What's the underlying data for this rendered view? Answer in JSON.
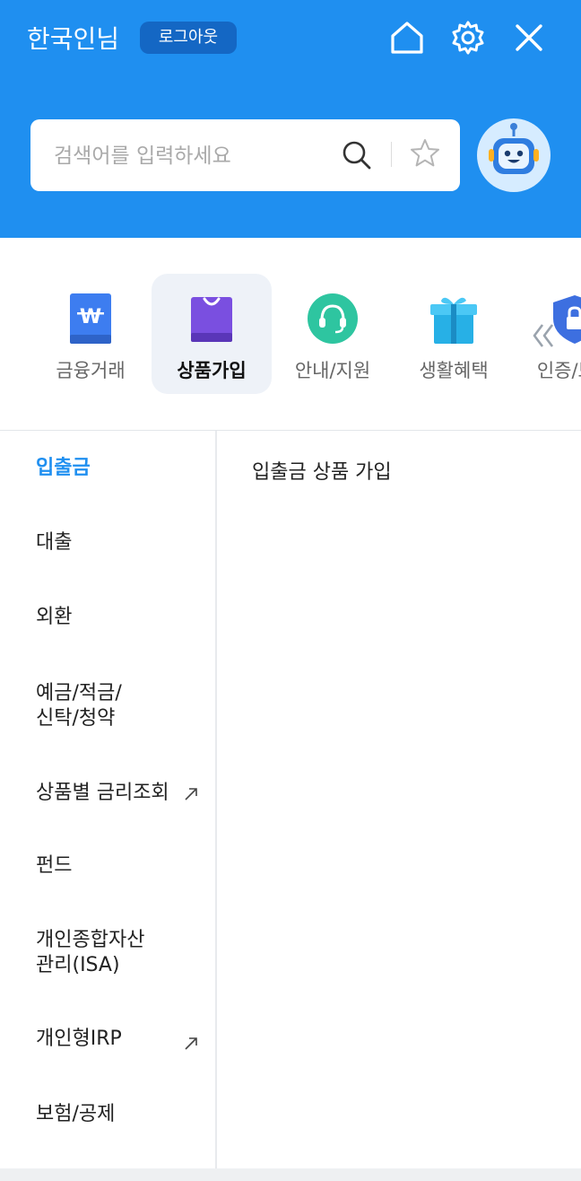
{
  "header": {
    "user_name": "한국인님",
    "logout_label": "로그아웃"
  },
  "search": {
    "placeholder": "검색어를 입력하세요",
    "value": ""
  },
  "categories": [
    {
      "label": "금융거래",
      "icon": "won-card-icon",
      "active": false
    },
    {
      "label": "상품가입",
      "icon": "shopping-bag-icon",
      "active": true
    },
    {
      "label": "안내/지원",
      "icon": "headset-icon",
      "active": false
    },
    {
      "label": "생활혜택",
      "icon": "gift-icon",
      "active": false
    },
    {
      "label": "인증/보안",
      "icon": "shield-lock-icon",
      "active": false
    }
  ],
  "side_menu": [
    {
      "label": "입출금",
      "active": true
    },
    {
      "label": "대출"
    },
    {
      "label": "외환"
    },
    {
      "label": "예금/적금/\n신탁/청약"
    },
    {
      "label": "상품별 금리조회",
      "external": true
    },
    {
      "label": "펀드"
    },
    {
      "label": "개인종합자산\n관리(ISA)"
    },
    {
      "label": "개인형IRP",
      "external": true
    },
    {
      "label": "보험/공제"
    }
  ],
  "content": {
    "title": "입출금 상품 가입"
  },
  "colors": {
    "brand": "#1f8ff0",
    "logout_bg": "#1467c4",
    "active_text": "#1f8ff0"
  }
}
